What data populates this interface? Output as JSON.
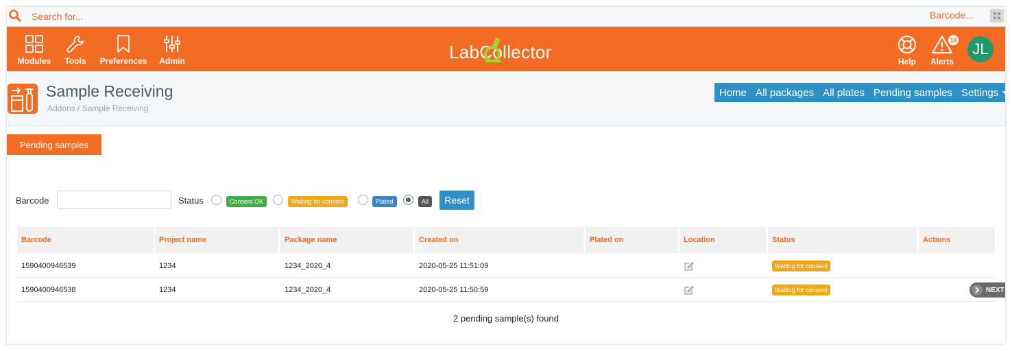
{
  "search": {
    "placeholder": "Search for...",
    "barcode_link": "Barcode..."
  },
  "nav": {
    "items": [
      {
        "label": "Modules",
        "icon": "grid-icon"
      },
      {
        "label": "Tools",
        "icon": "wrench-icon"
      },
      {
        "label": "Preferences",
        "icon": "bookmark-icon"
      },
      {
        "label": "Admin",
        "icon": "sliders-icon"
      }
    ],
    "logo_text": "LabCollector",
    "help_label": "Help",
    "alerts_label": "Alerts",
    "alerts_count": "10",
    "avatar_initials": "JL"
  },
  "page": {
    "title": "Sample Receiving",
    "breadcrumb": "Addons / Sample Receiving",
    "subnav": [
      "Home",
      "All packages",
      "All plates",
      "Pending samples",
      "Settings"
    ]
  },
  "tab_label": "Pending samples",
  "filters": {
    "barcode_label": "Barcode",
    "status_label": "Status",
    "status_options": [
      "Consent OK",
      "Waiting for consent",
      "Plated",
      "All"
    ],
    "selected_status": "All",
    "reset_label": "Reset"
  },
  "table": {
    "columns": [
      "Barcode",
      "Project name",
      "Package name",
      "Created on",
      "Plated on",
      "Location",
      "Status",
      "Actions"
    ],
    "rows": [
      {
        "barcode": "1590400946539",
        "project": "1234",
        "package": "1234_2020_4",
        "created": "2020-05-25 11:51:09",
        "plated": "",
        "status": "Waiting for consent"
      },
      {
        "barcode": "1590400946538",
        "project": "1234",
        "package": "1234_2020_4",
        "created": "2020-05-25 11:50:59",
        "plated": "",
        "status": "Waiting for consent"
      }
    ]
  },
  "next_label": "NEXT",
  "found_text": "2 pending sample(s) found",
  "colors": {
    "accent": "#f36c23",
    "blue": "#2f8fc7",
    "green": "#3fae49",
    "amber": "#f0a81b",
    "avatar": "#1f9a6c"
  }
}
